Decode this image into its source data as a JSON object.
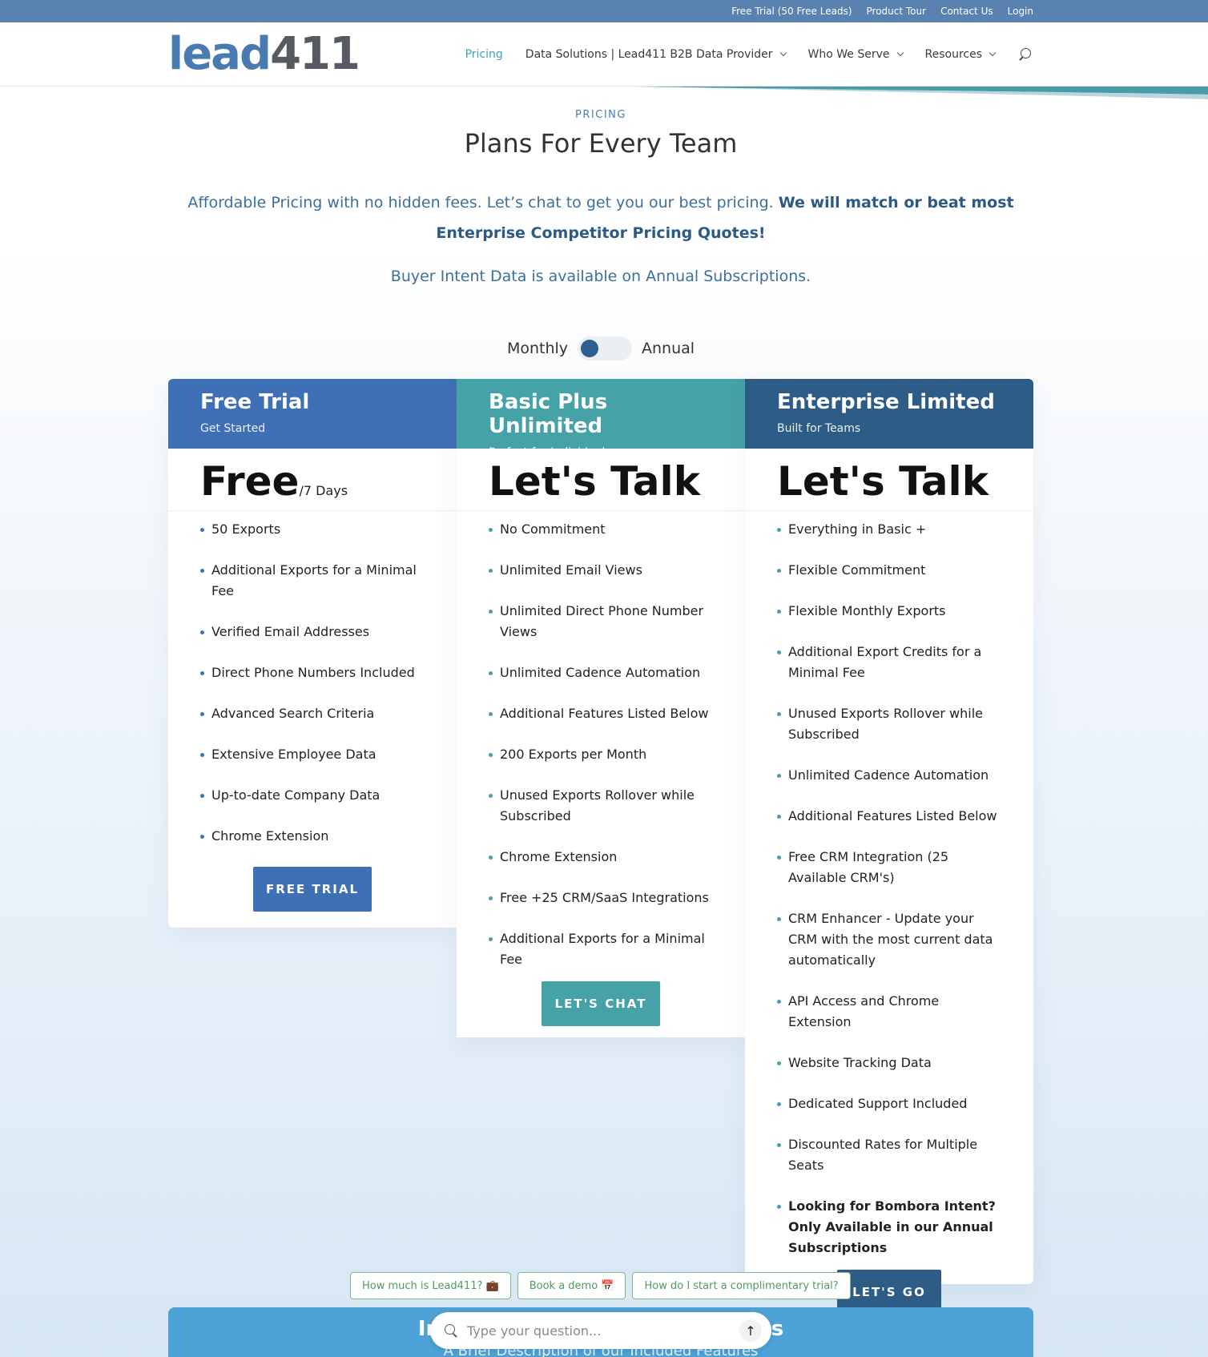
{
  "topbar": {
    "links": [
      "Free Trial (50 Free Leads)",
      "Product Tour",
      "Contact Us",
      "Login"
    ]
  },
  "header": {
    "logo_a": "lead",
    "logo_b": "411",
    "nav": [
      {
        "label": "Pricing",
        "active": true
      },
      {
        "label": "Data Solutions | Lead411 B2B Data Provider",
        "dropdown": true
      },
      {
        "label": "Who We Serve",
        "dropdown": true
      },
      {
        "label": "Resources",
        "dropdown": true
      }
    ]
  },
  "hero": {
    "eyebrow": "PRICING",
    "title": "Plans For Every Team",
    "sub_plain": "Affordable Pricing with no hidden fees. Let’s chat to get you our best pricing. ",
    "sub_bold": "We will match or beat most Enterprise Competitor Pricing Quotes!",
    "intent": "Buyer Intent Data is available on Annual Subscriptions."
  },
  "toggle": {
    "left": "Monthly",
    "right": "Annual",
    "selected": "Monthly"
  },
  "plans": [
    {
      "title": "Free Trial",
      "subtitle": "Get Started",
      "price": "Free",
      "per": "/7 Days",
      "features": [
        "50 Exports",
        "Additional Exports for a Minimal Fee",
        "Verified Email Addresses",
        "Direct Phone Numbers Included",
        "Advanced Search Criteria",
        "Extensive Employee Data",
        "Up-to-date Company Data",
        "Chrome Extension"
      ],
      "cta": "FREE TRIAL",
      "color": "#3f6fb5"
    },
    {
      "title": "Basic Plus Unlimited",
      "subtitle": "Perfect for Individuals",
      "price": "Let's Talk",
      "per": "",
      "features": [
        "No Commitment",
        "Unlimited Email Views",
        "Unlimited Direct Phone Number Views",
        "Unlimited Cadence Automation",
        "Additional Features Listed Below",
        "200 Exports per Month",
        "Unused Exports Rollover while Subscribed",
        "Chrome Extension",
        "Free +25 CRM/SaaS Integrations",
        "Additional Exports for a Minimal Fee"
      ],
      "cta": "LET'S CHAT",
      "color": "#45a2a6"
    },
    {
      "title": "Enterprise Limited",
      "subtitle": "Built for Teams",
      "price": "Let's Talk",
      "per": "",
      "features": [
        "Everything in Basic +",
        "Flexible Commitment",
        "Flexible Monthly Exports",
        "Additional Export Credits for a Minimal Fee",
        "Unused Exports Rollover while Subscribed",
        "Unlimited Cadence Automation",
        "Additional Features Listed Below",
        "Free CRM Integration (25 Available CRM's)",
        "CRM Enhancer - Update your CRM with the most current data automatically",
        "API Access and Chrome Extension",
        "Website Tracking Data",
        "Dedicated Support Included",
        "Discounted Rates for Multiple Seats"
      ],
      "bold_feature": "Looking for Bombora Intent? Only Available in our Annual Subscriptions",
      "cta": "LET'S GO",
      "color": "#2d5d87"
    }
  ],
  "chat": {
    "chips": [
      "How much is Lead411? 💼",
      "Book a demo 📅",
      "How do I start a complimentary trial?"
    ],
    "placeholder": "Type your question...",
    "send_icon": "arrow-up-icon"
  },
  "bottom": {
    "title": "Included Features Descriptions",
    "subtitle": "A Brief Description of our Included Features"
  }
}
